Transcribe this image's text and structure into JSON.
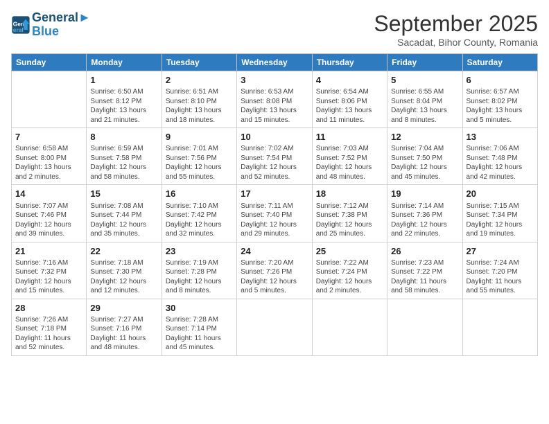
{
  "logo": {
    "line1": "General",
    "line2": "Blue"
  },
  "title": "September 2025",
  "subtitle": "Sacadat, Bihor County, Romania",
  "days_header": [
    "Sunday",
    "Monday",
    "Tuesday",
    "Wednesday",
    "Thursday",
    "Friday",
    "Saturday"
  ],
  "weeks": [
    [
      {
        "day": "",
        "info": ""
      },
      {
        "day": "1",
        "info": "Sunrise: 6:50 AM\nSunset: 8:12 PM\nDaylight: 13 hours\nand 21 minutes."
      },
      {
        "day": "2",
        "info": "Sunrise: 6:51 AM\nSunset: 8:10 PM\nDaylight: 13 hours\nand 18 minutes."
      },
      {
        "day": "3",
        "info": "Sunrise: 6:53 AM\nSunset: 8:08 PM\nDaylight: 13 hours\nand 15 minutes."
      },
      {
        "day": "4",
        "info": "Sunrise: 6:54 AM\nSunset: 8:06 PM\nDaylight: 13 hours\nand 11 minutes."
      },
      {
        "day": "5",
        "info": "Sunrise: 6:55 AM\nSunset: 8:04 PM\nDaylight: 13 hours\nand 8 minutes."
      },
      {
        "day": "6",
        "info": "Sunrise: 6:57 AM\nSunset: 8:02 PM\nDaylight: 13 hours\nand 5 minutes."
      }
    ],
    [
      {
        "day": "7",
        "info": "Sunrise: 6:58 AM\nSunset: 8:00 PM\nDaylight: 13 hours\nand 2 minutes."
      },
      {
        "day": "8",
        "info": "Sunrise: 6:59 AM\nSunset: 7:58 PM\nDaylight: 12 hours\nand 58 minutes."
      },
      {
        "day": "9",
        "info": "Sunrise: 7:01 AM\nSunset: 7:56 PM\nDaylight: 12 hours\nand 55 minutes."
      },
      {
        "day": "10",
        "info": "Sunrise: 7:02 AM\nSunset: 7:54 PM\nDaylight: 12 hours\nand 52 minutes."
      },
      {
        "day": "11",
        "info": "Sunrise: 7:03 AM\nSunset: 7:52 PM\nDaylight: 12 hours\nand 48 minutes."
      },
      {
        "day": "12",
        "info": "Sunrise: 7:04 AM\nSunset: 7:50 PM\nDaylight: 12 hours\nand 45 minutes."
      },
      {
        "day": "13",
        "info": "Sunrise: 7:06 AM\nSunset: 7:48 PM\nDaylight: 12 hours\nand 42 minutes."
      }
    ],
    [
      {
        "day": "14",
        "info": "Sunrise: 7:07 AM\nSunset: 7:46 PM\nDaylight: 12 hours\nand 39 minutes."
      },
      {
        "day": "15",
        "info": "Sunrise: 7:08 AM\nSunset: 7:44 PM\nDaylight: 12 hours\nand 35 minutes."
      },
      {
        "day": "16",
        "info": "Sunrise: 7:10 AM\nSunset: 7:42 PM\nDaylight: 12 hours\nand 32 minutes."
      },
      {
        "day": "17",
        "info": "Sunrise: 7:11 AM\nSunset: 7:40 PM\nDaylight: 12 hours\nand 29 minutes."
      },
      {
        "day": "18",
        "info": "Sunrise: 7:12 AM\nSunset: 7:38 PM\nDaylight: 12 hours\nand 25 minutes."
      },
      {
        "day": "19",
        "info": "Sunrise: 7:14 AM\nSunset: 7:36 PM\nDaylight: 12 hours\nand 22 minutes."
      },
      {
        "day": "20",
        "info": "Sunrise: 7:15 AM\nSunset: 7:34 PM\nDaylight: 12 hours\nand 19 minutes."
      }
    ],
    [
      {
        "day": "21",
        "info": "Sunrise: 7:16 AM\nSunset: 7:32 PM\nDaylight: 12 hours\nand 15 minutes."
      },
      {
        "day": "22",
        "info": "Sunrise: 7:18 AM\nSunset: 7:30 PM\nDaylight: 12 hours\nand 12 minutes."
      },
      {
        "day": "23",
        "info": "Sunrise: 7:19 AM\nSunset: 7:28 PM\nDaylight: 12 hours\nand 8 minutes."
      },
      {
        "day": "24",
        "info": "Sunrise: 7:20 AM\nSunset: 7:26 PM\nDaylight: 12 hours\nand 5 minutes."
      },
      {
        "day": "25",
        "info": "Sunrise: 7:22 AM\nSunset: 7:24 PM\nDaylight: 12 hours\nand 2 minutes."
      },
      {
        "day": "26",
        "info": "Sunrise: 7:23 AM\nSunset: 7:22 PM\nDaylight: 11 hours\nand 58 minutes."
      },
      {
        "day": "27",
        "info": "Sunrise: 7:24 AM\nSunset: 7:20 PM\nDaylight: 11 hours\nand 55 minutes."
      }
    ],
    [
      {
        "day": "28",
        "info": "Sunrise: 7:26 AM\nSunset: 7:18 PM\nDaylight: 11 hours\nand 52 minutes."
      },
      {
        "day": "29",
        "info": "Sunrise: 7:27 AM\nSunset: 7:16 PM\nDaylight: 11 hours\nand 48 minutes."
      },
      {
        "day": "30",
        "info": "Sunrise: 7:28 AM\nSunset: 7:14 PM\nDaylight: 11 hours\nand 45 minutes."
      },
      {
        "day": "",
        "info": ""
      },
      {
        "day": "",
        "info": ""
      },
      {
        "day": "",
        "info": ""
      },
      {
        "day": "",
        "info": ""
      }
    ]
  ]
}
